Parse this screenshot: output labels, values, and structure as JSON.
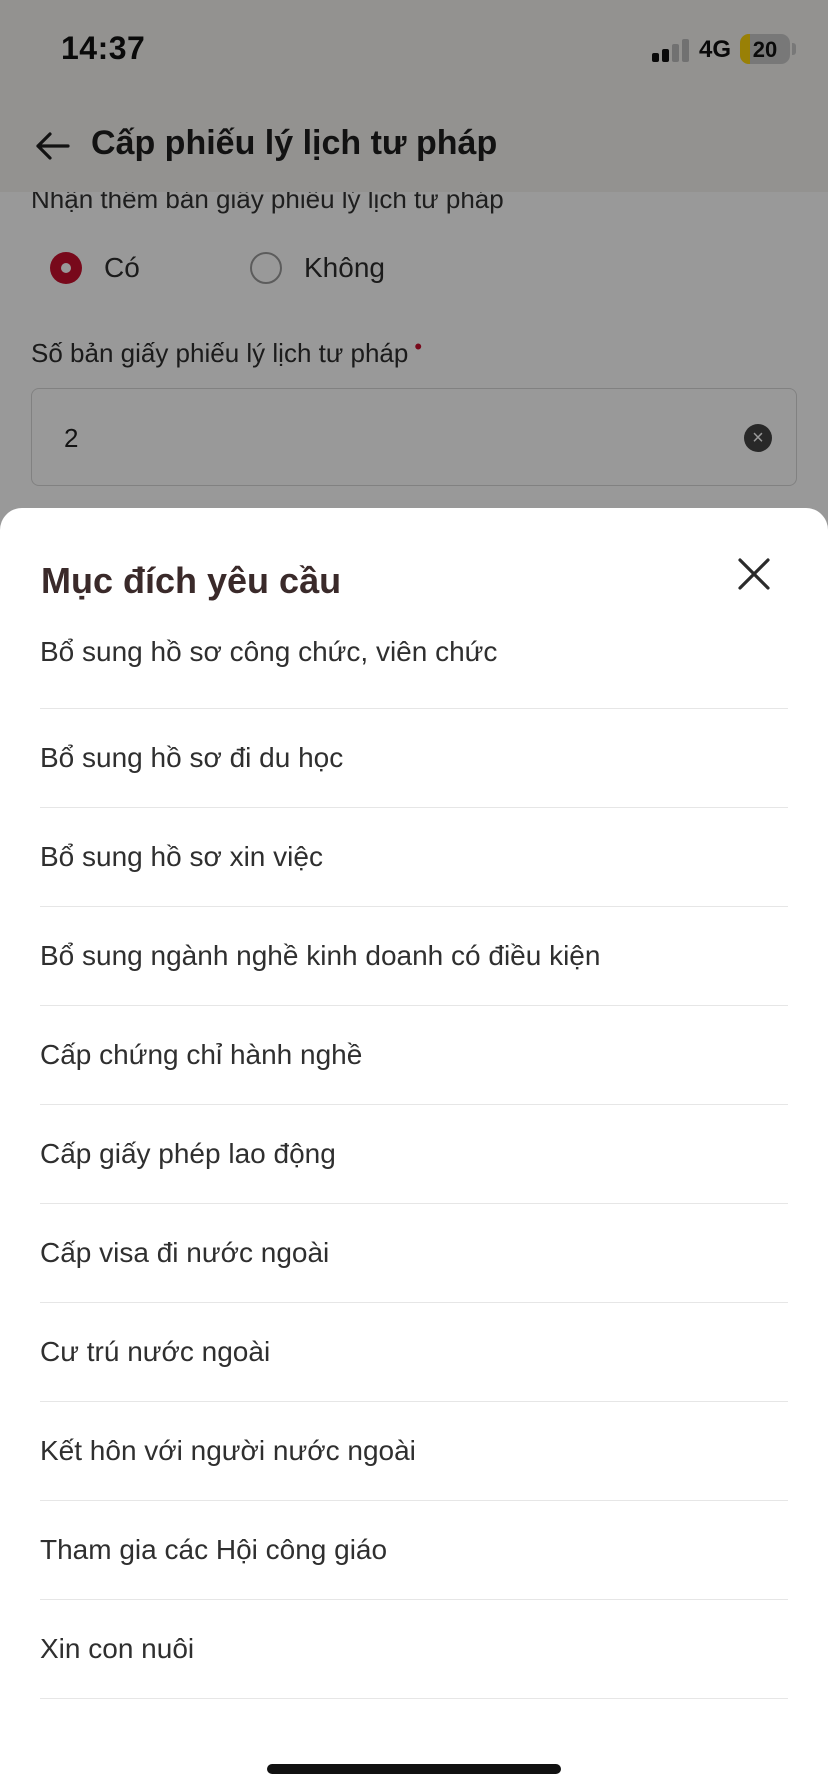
{
  "status_bar": {
    "time": "14:37",
    "network": "4G",
    "battery": "20",
    "battery_fraction": 0.2,
    "battery_color": "#ffd60a"
  },
  "header": {
    "back_icon": "arrow-left-icon",
    "title": "Cấp phiếu lý lịch tư pháp"
  },
  "form": {
    "receive_paper_label": "Nhận thêm bản giấy phiếu lý lịch tư pháp",
    "options": [
      {
        "label": "Có",
        "checked": true
      },
      {
        "label": "Không",
        "checked": false
      }
    ],
    "copies_label": "Số bản giấy phiếu lý lịch tư pháp",
    "required_mark": "•",
    "copies_value": "2",
    "clear_icon": "clear-circle-icon",
    "accent_color": "#c8102e"
  },
  "sheet": {
    "title": "Mục đích yêu cầu",
    "close_icon": "close-icon",
    "items": [
      "Bổ sung hồ sơ công chức, viên chức",
      "Bổ sung hồ sơ đi du học",
      "Bổ sung hồ sơ xin việc",
      "Bổ sung ngành nghề kinh doanh có điều kiện",
      "Cấp chứng chỉ hành nghề",
      "Cấp giấy phép lao động",
      "Cấp visa đi nước ngoài",
      "Cư trú nước ngoài",
      "Kết hôn với người nước ngoài",
      "Tham gia các Hội công giáo",
      "Xin con nuôi"
    ]
  }
}
